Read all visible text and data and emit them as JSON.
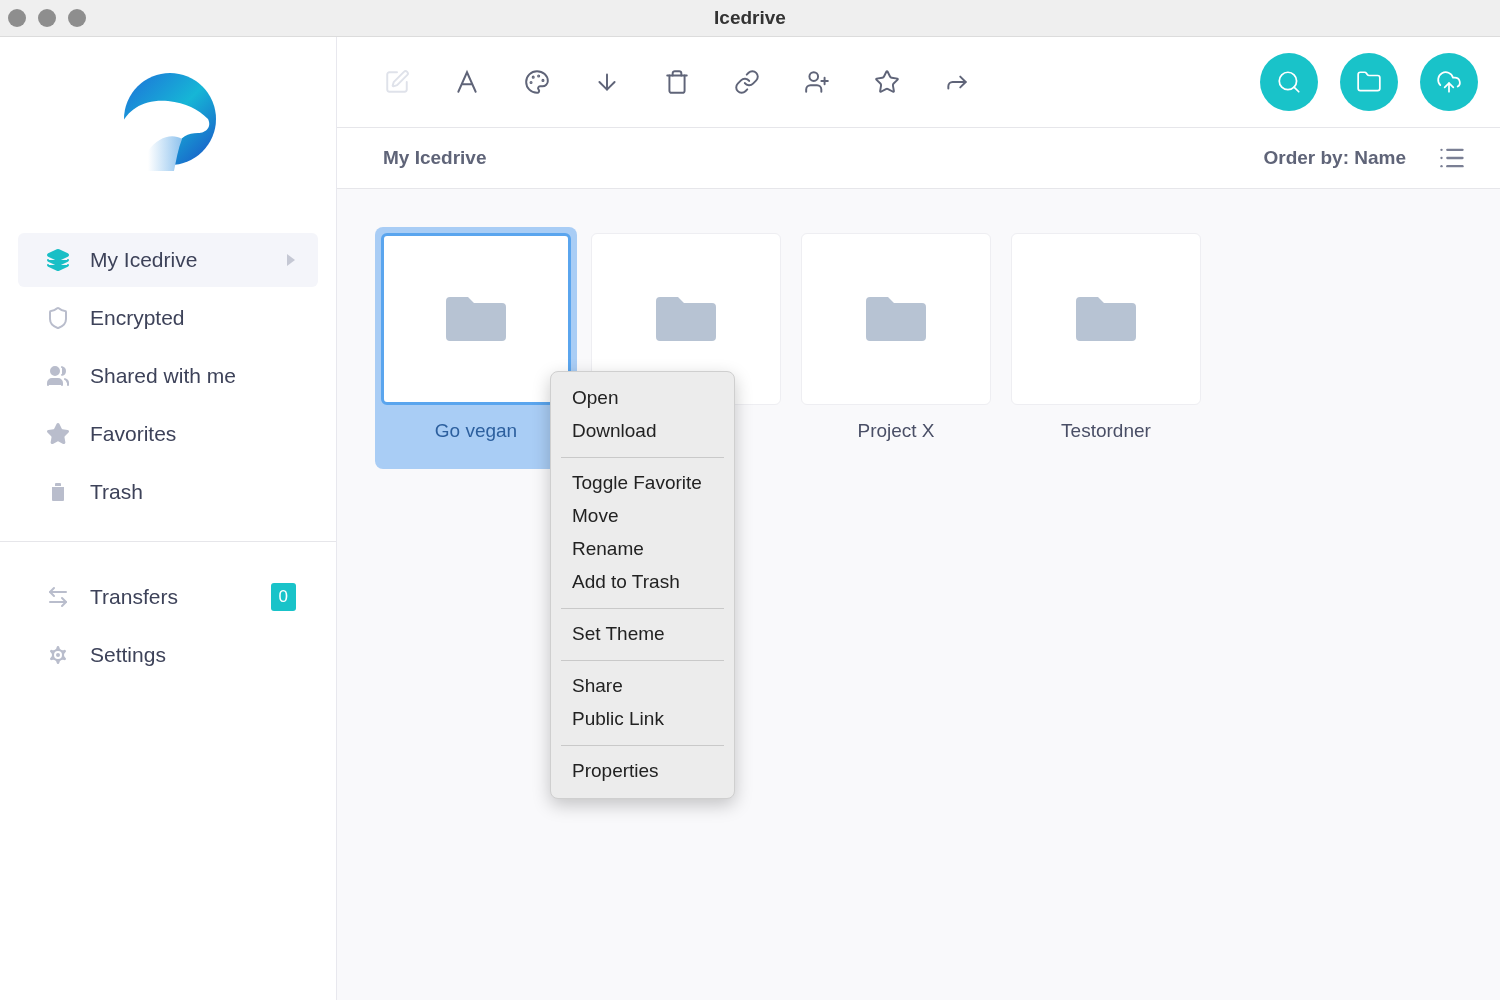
{
  "window": {
    "title": "Icedrive"
  },
  "sidebar": {
    "groups": [
      {
        "items": [
          {
            "kind": "layers",
            "label": "My Icedrive",
            "selected": true
          },
          {
            "kind": "shield",
            "label": "Encrypted",
            "selected": false
          },
          {
            "kind": "users",
            "label": "Shared with me",
            "selected": false
          },
          {
            "kind": "star",
            "label": "Favorites",
            "selected": false
          },
          {
            "kind": "trash",
            "label": "Trash",
            "selected": false
          }
        ]
      },
      {
        "items": [
          {
            "kind": "transfers",
            "label": "Transfers",
            "badge": "0",
            "selected": false
          },
          {
            "kind": "settings",
            "label": "Settings",
            "selected": false
          }
        ]
      }
    ]
  },
  "toolbar": {
    "tools": [
      {
        "kind": "edit",
        "disabled": true
      },
      {
        "kind": "font",
        "disabled": false
      },
      {
        "kind": "palette",
        "disabled": false
      },
      {
        "kind": "download",
        "disabled": false
      },
      {
        "kind": "trash",
        "disabled": false
      },
      {
        "kind": "link",
        "disabled": false
      },
      {
        "kind": "user-plus",
        "disabled": false
      },
      {
        "kind": "star",
        "disabled": false
      },
      {
        "kind": "share",
        "disabled": false
      }
    ],
    "actions": [
      {
        "kind": "search"
      },
      {
        "kind": "folder"
      },
      {
        "kind": "upload"
      }
    ]
  },
  "breadcrumb": "My Icedrive",
  "order_by": "Order by: Name",
  "folders": [
    {
      "name": "Go vegan",
      "selected": true
    },
    {
      "selected": false
    },
    {
      "name": "Project X",
      "selected": false
    },
    {
      "name": "Testordner",
      "selected": false
    }
  ],
  "context_menu": {
    "groups": [
      [
        "Open",
        "Download"
      ],
      [
        "Toggle Favorite",
        "Move",
        "Rename",
        "Add to Trash"
      ],
      [
        "Set Theme"
      ],
      [
        "Share",
        "Public Link"
      ],
      [
        "Properties"
      ]
    ]
  }
}
